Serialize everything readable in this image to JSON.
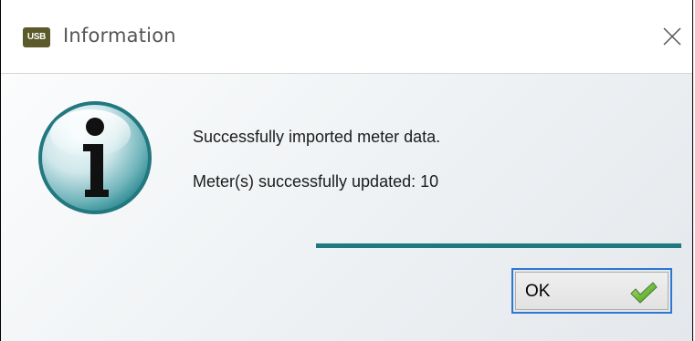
{
  "window": {
    "app_badge": "USB",
    "title": "Information",
    "close_icon": "close-icon"
  },
  "message": {
    "line1": "Successfully imported meter data.",
    "line2": "Meter(s) successfully updated: 10",
    "icon": "info-icon"
  },
  "progress": {
    "fraction": 1.0,
    "color": "#1e7a80"
  },
  "buttons": {
    "ok_label": "OK",
    "ok_icon": "checkmark-icon"
  },
  "colors": {
    "accent": "#2b78d4",
    "info_teal": "#1e7a80"
  }
}
